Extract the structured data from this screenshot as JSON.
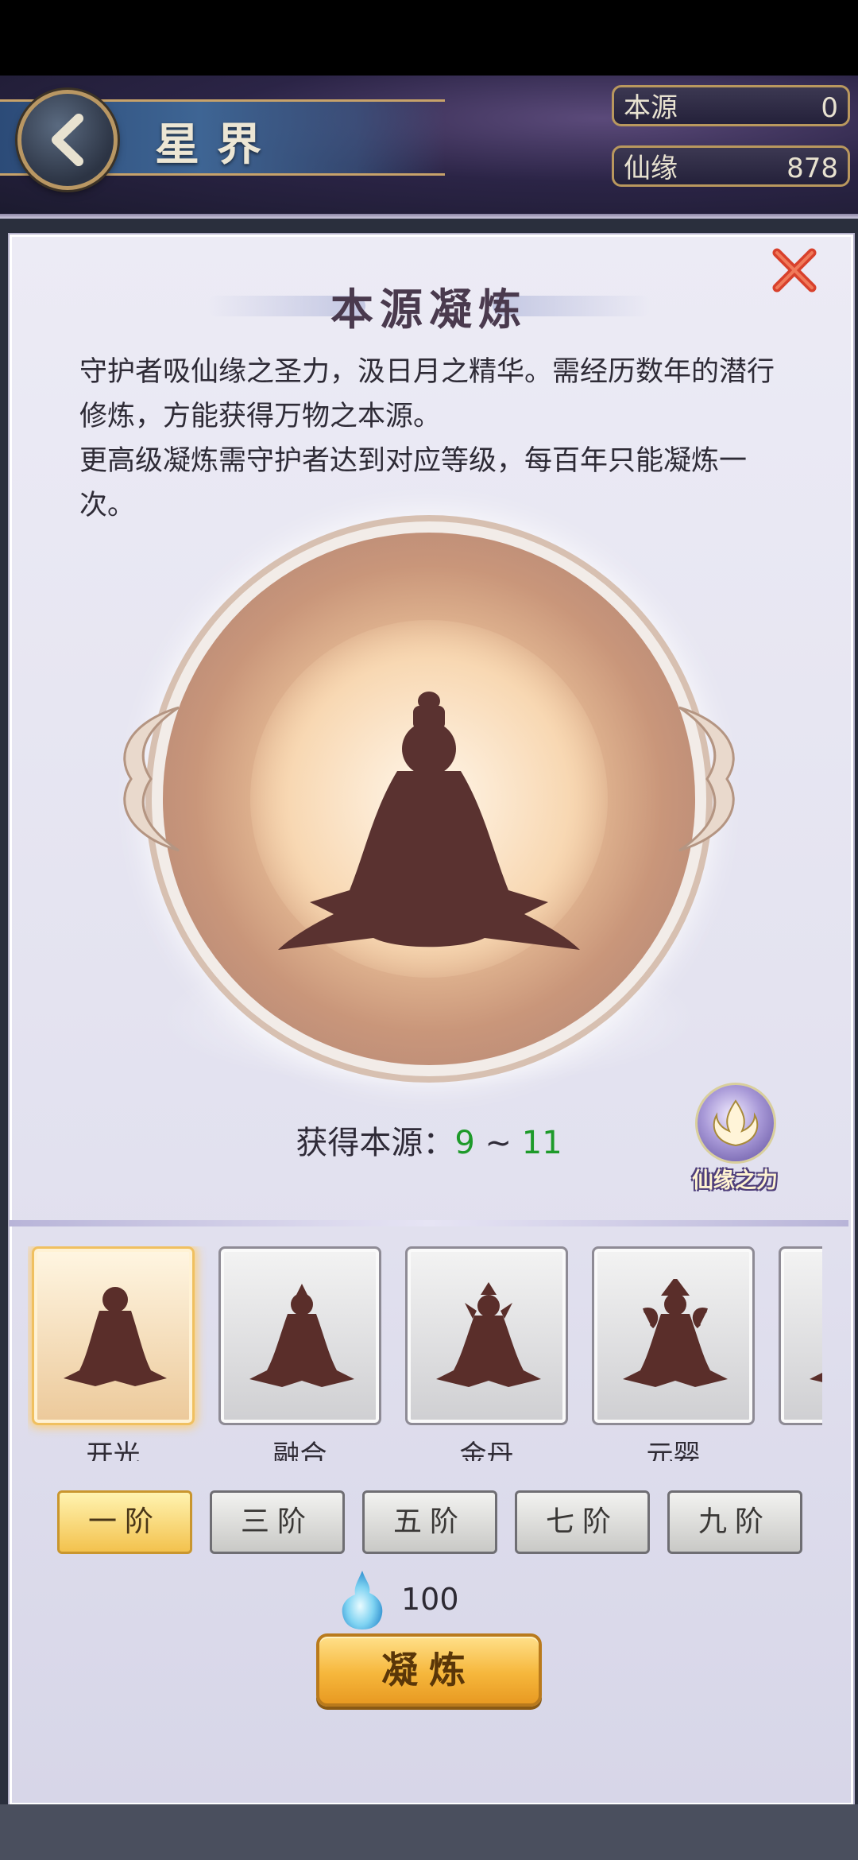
{
  "header": {
    "title": "星界",
    "currencies": [
      {
        "label": "本源",
        "value": "0"
      },
      {
        "label": "仙缘",
        "value": "878"
      }
    ]
  },
  "dialog": {
    "title": "本源凝炼",
    "description": [
      "守护者吸仙缘之圣力，汲日月之精华。需经历数年的潜行修炼，方能获得万物之本源。",
      "更高级凝炼需守护者达到对应等级，每百年只能凝炼一次。"
    ],
    "yield_label": "获得本源：",
    "yield_min": "9",
    "yield_sep": " ~ ",
    "yield_max": "11",
    "power_label": "仙缘之力"
  },
  "realms": [
    {
      "name": "开光",
      "selected": true
    },
    {
      "name": "融合",
      "selected": false
    },
    {
      "name": "金丹",
      "selected": false
    },
    {
      "name": "元婴",
      "selected": false
    },
    {
      "name": "",
      "selected": false
    }
  ],
  "tiers": [
    {
      "label": "一阶",
      "selected": true
    },
    {
      "label": "三阶",
      "selected": false
    },
    {
      "label": "五阶",
      "selected": false
    },
    {
      "label": "七阶",
      "selected": false
    },
    {
      "label": "九阶",
      "selected": false
    }
  ],
  "cost": {
    "amount": "100",
    "icon": "spirit-flame-icon"
  },
  "action": {
    "refine_label": "凝炼"
  },
  "colors": {
    "accent_gold": "#f6b73c",
    "yield_green": "#1e9a2a"
  }
}
